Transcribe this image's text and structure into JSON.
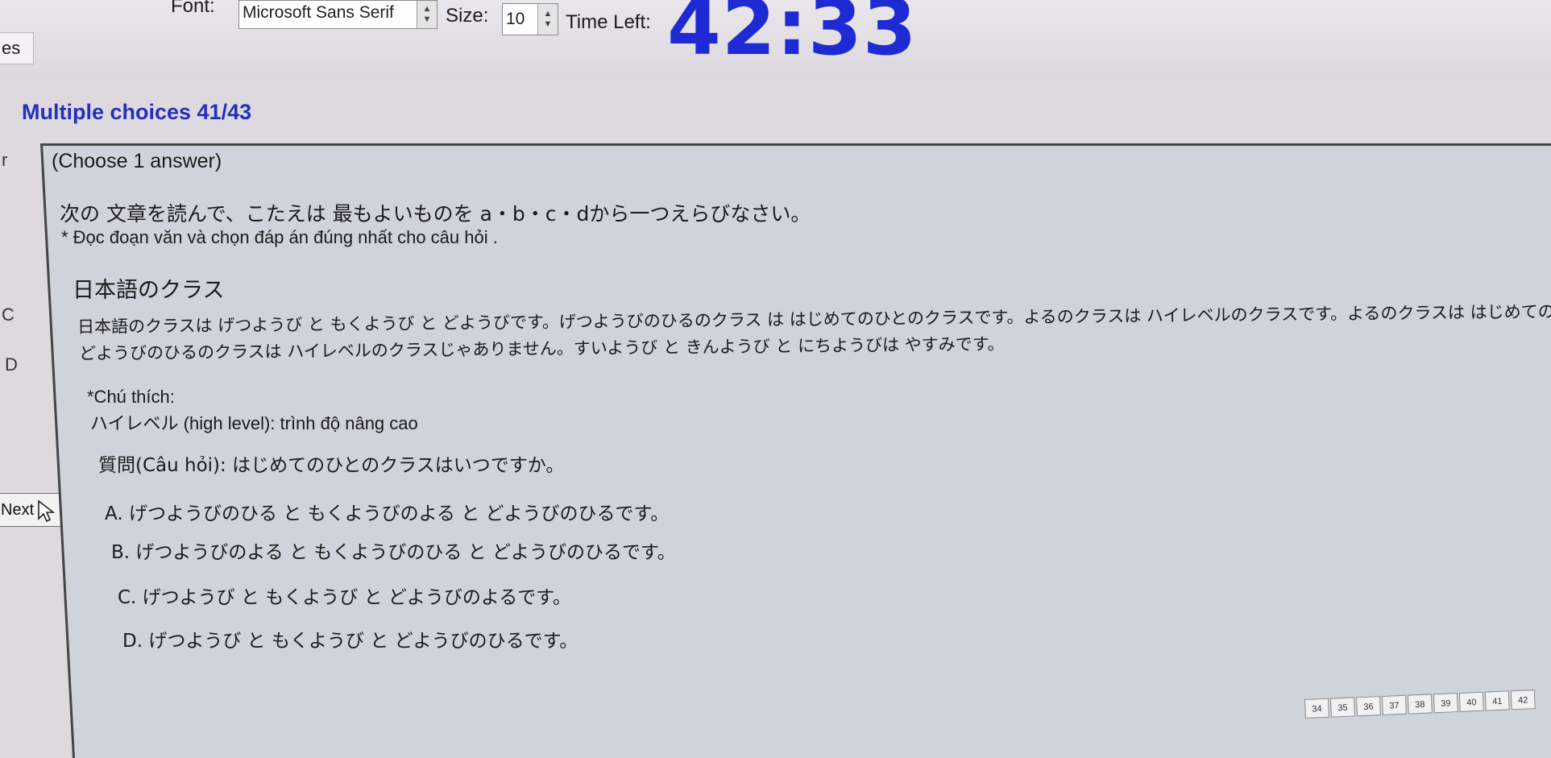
{
  "toolbar": {
    "font_label": "Font:",
    "font_value": "Microsoft Sans Serif",
    "size_label": "Size:",
    "size_value": "10",
    "time_label": "Time Left:",
    "time_value": "42:33"
  },
  "side_tab": {
    "label": "es"
  },
  "section": {
    "title": "Multiple choices 41/43"
  },
  "left_strip": {
    "letters": [
      "r",
      "C",
      "D"
    ],
    "next_label": "Next"
  },
  "question": {
    "choose": "(Choose 1 answer)",
    "instruction_jp": "次の 文章を読んで、こたえは 最もよいものを  a・b・c・dから一つえらびなさい。",
    "instruction_vn": "* Đọc đoạn văn và chọn đáp án đúng nhất cho câu hỏi .",
    "passage_title": "日本語のクラス",
    "passage_line1": "日本語のクラスは げつようび と もくようび と どようびです。げつようびのひるのクラス は はじめてのひとのクラスです。よるのクラスは ハイレベルのクラスです。よるのクラスは はじめてのひとのクラスじゃありません。もくようびと",
    "passage_line2": "どようびのひるのクラスは ハイレベルのクラスじゃありません。すいようび と きんようび と にちようびは やすみです。",
    "note_label": "*Chú thích:",
    "note_text": "ハイレベル (high level): trình độ nâng cao",
    "question_text": "質問(Câu  hỏi): はじめてのひとのクラスはいつですか。",
    "options": [
      "A.  げつようびのひる と もくようびのよる と どようびのひるです。",
      "B.  げつようびのよる と もくようびのひる と どようびのひるです。",
      "C.  げつようび と もくようび と どようびのよるです。",
      "D.  げつようび と もくようび と どようびのひるです。"
    ]
  },
  "pager": {
    "pages": [
      "34",
      "35",
      "36",
      "37",
      "38",
      "39",
      "40",
      "41",
      "42"
    ]
  },
  "colors": {
    "timer": "#1e2bd4",
    "title": "#2431b9",
    "panel": "#ced3dc"
  }
}
